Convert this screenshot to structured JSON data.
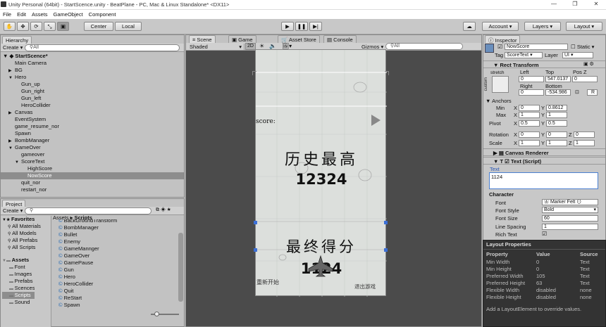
{
  "titlebar": {
    "text": "Unity Personal (64bit) - StartScence.unity - BeatPlane - PC, Mac & Linux Standalone* <DX11>"
  },
  "menu": [
    "File",
    "Edit",
    "Assets",
    "GameObject",
    "Component"
  ],
  "toolbar": {
    "center": "Center",
    "local": "Local",
    "account": "Account",
    "layers": "Layers",
    "layout": "Layout"
  },
  "hierarchy": {
    "tab": "Hierarchy",
    "create": "Create",
    "search": "All",
    "scene": "StartScence*",
    "items": [
      {
        "label": "Main Camera",
        "indent": 1,
        "arrow": ""
      },
      {
        "label": "BG",
        "indent": 1,
        "arrow": "▶"
      },
      {
        "label": "Hero",
        "indent": 1,
        "arrow": "▼"
      },
      {
        "label": "Gun_up",
        "indent": 2,
        "arrow": ""
      },
      {
        "label": "Gun_right",
        "indent": 2,
        "arrow": ""
      },
      {
        "label": "Gun_left",
        "indent": 2,
        "arrow": ""
      },
      {
        "label": "HeroCollider",
        "indent": 2,
        "arrow": ""
      },
      {
        "label": "Canvas",
        "indent": 1,
        "arrow": "▶"
      },
      {
        "label": "EventSystem",
        "indent": 1,
        "arrow": ""
      },
      {
        "label": "game_resume_nor",
        "indent": 1,
        "arrow": ""
      },
      {
        "label": "Spawn",
        "indent": 1,
        "arrow": ""
      },
      {
        "label": "BombManager",
        "indent": 1,
        "arrow": "▶"
      },
      {
        "label": "GameOver",
        "indent": 1,
        "arrow": "▼"
      },
      {
        "label": "gameover",
        "indent": 2,
        "arrow": ""
      },
      {
        "label": "ScoreText",
        "indent": 2,
        "arrow": "▼"
      },
      {
        "label": "HighScore",
        "indent": 3,
        "arrow": ""
      },
      {
        "label": "NowScore",
        "indent": 3,
        "arrow": "",
        "selected": true
      },
      {
        "label": "quit_nor",
        "indent": 2,
        "arrow": ""
      },
      {
        "label": "restart_nor",
        "indent": 2,
        "arrow": ""
      }
    ]
  },
  "project": {
    "tab": "Project",
    "create": "Create",
    "breadcrumb_root": "Assets",
    "breadcrumb_sep": "▸",
    "breadcrumb_leaf": "Scripts",
    "favorites": [
      "Favorites",
      "All Materials",
      "All Models",
      "All Prefabs",
      "All Scripts"
    ],
    "assets": [
      "Assets",
      "Font",
      "Images",
      "Prefabs",
      "Scences",
      "Scripts",
      "Sound"
    ],
    "files": [
      "BackGroundTransform",
      "BombManager",
      "Bullet",
      "Enemy",
      "GameMannger",
      "GameOver",
      "GamePause",
      "Gun",
      "Hero",
      "HeroCollider",
      "Quit",
      "ReStart",
      "Spawn"
    ]
  },
  "scene": {
    "tabs": [
      "Scene",
      "Game",
      "Asset Store",
      "Console"
    ],
    "shaded": "Shaded",
    "mode2d": "2D",
    "gizmos": "Gizmos",
    "search": "All"
  },
  "game": {
    "score_label": "score:",
    "history_title": "历史最高",
    "history_score": "12324",
    "final_title": "最终得分",
    "final_score": "1124",
    "quit_text": "退出游戏",
    "restart_text": "重新开始"
  },
  "inspector": {
    "tab": "Inspector",
    "name": "NowScore",
    "static": "Static",
    "tag_label": "Tag",
    "tag": "ScoreText",
    "layer_label": "Layer",
    "layer": "UI",
    "rect": {
      "title": "Rect Transform",
      "stretch": "stretch",
      "custom": "custom",
      "left": "Left",
      "top": "Top",
      "posz": "Pos Z",
      "left_v": "0",
      "top_v": "547.0137",
      "posz_v": "0",
      "right": "Right",
      "bottom": "Bottom",
      "right_v": "0",
      "bottom_v": "-534.986",
      "r_btn": "R"
    },
    "anchors": "Anchors",
    "min": "Min",
    "max": "Max",
    "pivot": "Pivot",
    "rotation": "Rotation",
    "scale": "Scale",
    "min_x": "0",
    "min_y": "0.8612",
    "max_x": "1",
    "max_y": "1",
    "pivot_x": "0.5",
    "pivot_y": "0.5",
    "rot_x": "0",
    "rot_y": "0",
    "rot_z": "0",
    "scale_x": "1",
    "scale_y": "1",
    "scale_z": "1",
    "canvas_renderer": "Canvas Renderer",
    "text_script": "Text (Script)",
    "text_label": "Text",
    "text_value": "1124",
    "character": "Character",
    "font_label": "Font",
    "font": "Marker Felt",
    "style_label": "Font Style",
    "style": "Bold",
    "size_label": "Font Size",
    "size": "60",
    "spacing_label": "Line Spacing",
    "spacing": "1",
    "rich_label": "Rich Text"
  },
  "layout_props": {
    "title": "Layout Properties",
    "cols": [
      "Property",
      "Value",
      "Source"
    ],
    "rows": [
      [
        "Min Width",
        "0",
        "Text"
      ],
      [
        "Min Height",
        "0",
        "Text"
      ],
      [
        "Preferred Width",
        "105",
        "Text"
      ],
      [
        "Preferred Height",
        "63",
        "Text"
      ],
      [
        "Flexible Width",
        "disabled",
        "none"
      ],
      [
        "Flexible Height",
        "disabled",
        "none"
      ]
    ],
    "footer": "Add a LayoutElement to override values."
  }
}
